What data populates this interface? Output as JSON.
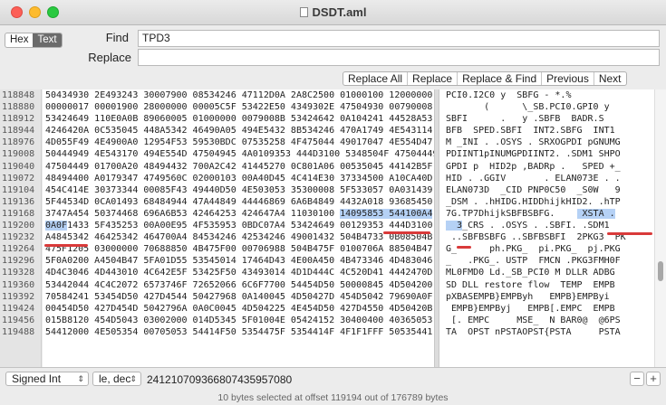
{
  "window": {
    "title": "DSDT.aml"
  },
  "toolbar": {
    "mode_hex": "Hex",
    "mode_text": "Text",
    "find_label": "Find",
    "find_value": "TPD3",
    "replace_label": "Replace",
    "replace_value": "",
    "buttons": [
      "Replace All",
      "Replace",
      "Replace & Find",
      "Previous",
      "Next"
    ]
  },
  "offsets": [
    "118848",
    "118880",
    "118912",
    "118944",
    "118976",
    "119008",
    "119040",
    "119072",
    "119104",
    "119136",
    "119168",
    "119200",
    "119232",
    "119264",
    "119296",
    "119328",
    "119360",
    "119392",
    "119424",
    "119456",
    "119488"
  ],
  "hex_rows": [
    "50434930 2E493243 30007900 08534246 47112D0A 2A8C2500 01000100 12000000",
    "00000017 00001900 28000000 00005C5F 53422E50 4349302E 47504930 00790008",
    "53424649 110E0A0B 89060005 01000000 0079008B 53424642 0A104241 44528A53",
    "4246420A 0C535045 448A5342 46490A05 494E5432 8B534246 470A1749 4E543114",
    "4D055F49 4E4900A0 12954F53 59530BDC 07535258 4F475044 49017047 4E554D47",
    "50444949 4E543170 494E554D 47504945 4A0109353 444D3100 5348504F 47504449",
    "47504449 01700A20 48494432 700A2C42 41445270 0C801A06 00535045 44142B5F",
    "48494400 A0179347 4749560C 02000103 00A40D45 4C414E30 37334500 A10CA40D",
    "454C414E 30373344 00085F43 49440D50 4E503053 35300008 5F533057 0A031439",
    "5F44534D 0CA01493 68484944 47A44849 44446869 6A6B4849 4432A018 93685450",
    "3747A454 50374468 696A6B53 42464253 424647A4 11030100 14095853 544100A4",
    "0A0F1433 5F435253 00A00E95 4F535953 0BDC07A4 53424649 00129353 444D3100",
    "A4845342 46425342 464700A4 84534246 42534246 49001432 504B4733 0B08504B",
    "475F1205 03000000 70688850 4B475F00 00706988 504B475F 0100706A 88504B47",
    "5F0A0200 A4504B47 5FA01D55 53545014 17464D43 4E00A450 4B473346 4D483046",
    "4D4C3046 4D443010 4C642E5F 53425F50 43493014 4D1D444C 4C520D41 4442470D",
    "53442044 4C4C2072 6573746F 72652066 6C6F7700 54454D50 50000845 4D504200",
    "70584241 53454D50 427D4544 50427968 0A140045 4D50427D 454D5042 79690A0F",
    "00454D50 427D454D 5042796A 0A0C0045 4D504225 4E454D50 427D4550 4D50420B",
    "015B8120 454D5043 03002000 014D5345 5F01004E 05424152 30400400 40365053",
    "54412000 4E505354 00705053 54414F50 5354475F 5354414F 4F1F1FFF 50535441"
  ],
  "ascii_rows": [
    "PCI0.I2C0 y  SBFG - *.%",
    "       (      \\_SB.PCI0.GPI0 y",
    "SBFI      .   y .SBFB  BADR.S",
    "BFB  SPED.SBFI  INT2.SBFG  INT1",
    "M _INI . .OSYS . SRXOGPDI pGNUMG",
    "PDIINT1pINUMGPDIINT2. .SDM1 SHPO",
    "GPDI p  HID2p ,BADRp .   SPED +_",
    "HID . .GGIV       . ELAN073E . .",
    "ELAN073D  _CID PNP0C50  _S0W   9",
    "_DSM . .hHIDG.HIDDhijkHID2. .hTP",
    "7G.TP7DhijkSBFBSBFG.     XSTA .",
    "  3_CRS . .OSYS . .SBFI. .SDM1",
    " ..SBFBSBFG ..SBFBSBFI  2PKG3  PK",
    "G_      ph.PKG_  pi.PKG_  pj.PKG",
    "_   .PKG_. USTP  FMCN .PKG3FMH0F",
    "ML0FMD0 Ld._SB_PCI0 M DLLR ADBG",
    "SD DLL restore flow  TEMP  EMPB",
    "pXBASEMPB}EMPByh   EMPB}EMPByi",
    " EMPB}EMPByj   EMPB[.EMPC  EMPB",
    " [. EMPC     MSE_  N BAR0@  @6PS",
    "TA  OPST nPSTAOPST{PSTA     PSTA"
  ],
  "status": {
    "type_select": "Signed Int",
    "endian_select": "le, dec",
    "value": "2412107093668074359570 80",
    "value_display": "24121070936680743595708 0",
    "value_exact": "241210709366807435957080",
    "selection_info": "10 bytes selected at offset 119194 out of 176789 bytes",
    "minus": "−",
    "plus": "+"
  },
  "colors": {
    "highlight": "#b5d1f5",
    "annotation": "#d93a3a"
  }
}
